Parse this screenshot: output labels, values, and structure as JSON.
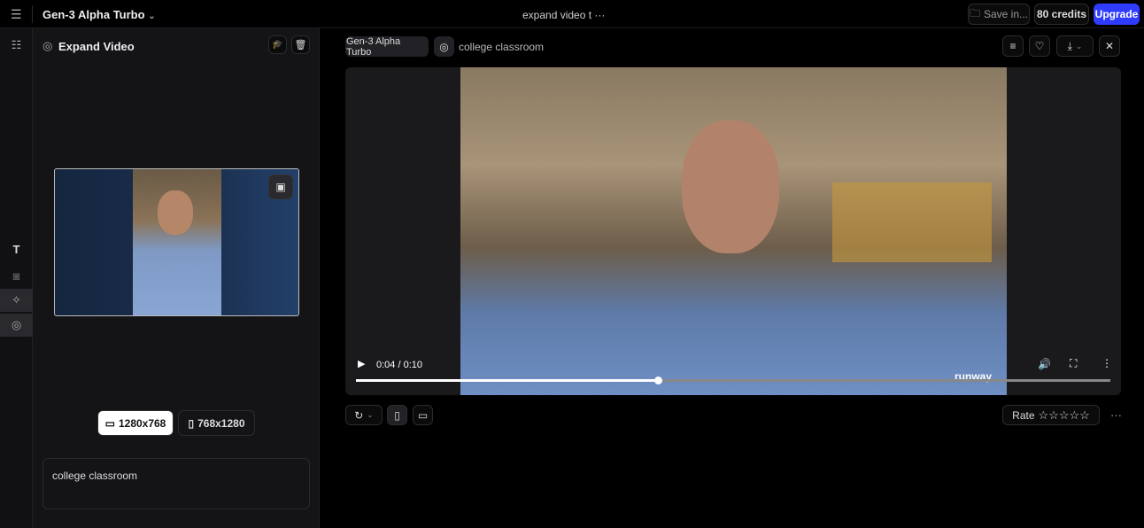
{
  "topbar": {
    "model": "Gen-3 Alpha Turbo",
    "doc_title": "expand video t",
    "save": "Save in...",
    "credits": "80 credits",
    "upgrade": "Upgrade"
  },
  "panel": {
    "title": "Expand Video",
    "ratio_landscape": "1280x768",
    "ratio_portrait": "768x1280",
    "prompt": "college classroom"
  },
  "main": {
    "model_chip": "Gen-3 Alpha Turbo",
    "prompt": "college classroom",
    "time": "0:04 / 0:10",
    "progress": 0.4,
    "watermark": "runway",
    "rate": "Rate",
    "stars": 5
  },
  "colors": {
    "accent": "#2f3cff"
  }
}
